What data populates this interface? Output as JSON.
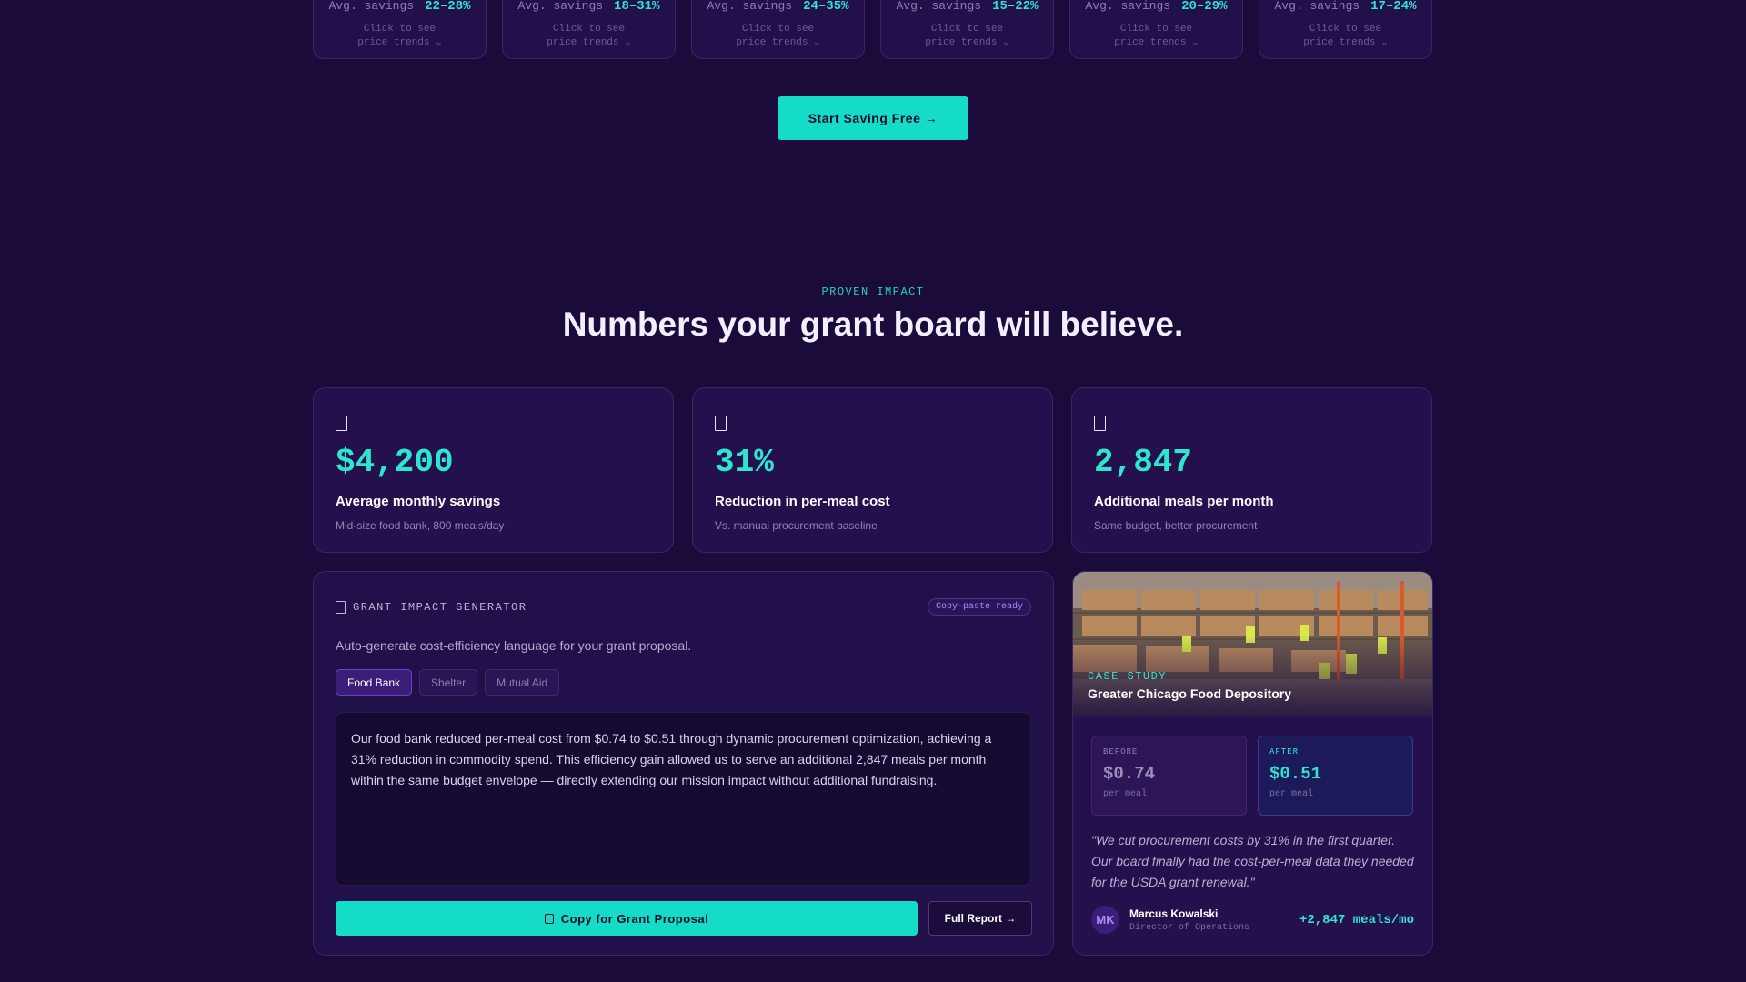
{
  "price_cards": [
    {
      "label": "Avg. savings",
      "value": "22–28%",
      "hint": "Click to see price trends ⌄"
    },
    {
      "label": "Avg. savings",
      "value": "18–31%",
      "hint": "Click to see price trends ⌄"
    },
    {
      "label": "Avg. savings",
      "value": "24–35%",
      "hint": "Click to see price trends ⌄"
    },
    {
      "label": "Avg. savings",
      "value": "15–22%",
      "hint": "Click to see price trends ⌄"
    },
    {
      "label": "Avg. savings",
      "value": "20–29%",
      "hint": "Click to see price trends ⌄"
    },
    {
      "label": "Avg. savings",
      "value": "17–24%",
      "hint": "Click to see price trends ⌄"
    }
  ],
  "cta": {
    "label": "Start Saving Free →"
  },
  "impact": {
    "eyebrow": "PROVEN IMPACT",
    "heading": "Numbers your grant board will believe.",
    "stats": [
      {
        "icon": "document-icon",
        "value": "$4,200",
        "label": "Average monthly savings",
        "sub": "Mid-size food bank, 800 meals/day"
      },
      {
        "icon": "document-icon",
        "value": "31%",
        "label": "Reduction in per-meal cost",
        "sub": "Vs. manual procurement baseline"
      },
      {
        "icon": "document-icon",
        "value": "2,847",
        "label": "Additional meals per month",
        "sub": "Same budget, better procurement"
      }
    ]
  },
  "grant": {
    "title": "GRANT IMPACT GENERATOR",
    "badge": "Copy-paste ready",
    "description": "Auto-generate cost-efficiency language for your grant proposal.",
    "tabs": [
      "Food Bank",
      "Shelter",
      "Mutual Aid"
    ],
    "active_tab": "Food Bank",
    "output_text": "Our food bank reduced per-meal cost from $0.74 to $0.51 through dynamic procurement optimization, achieving a 31% reduction in commodity spend. This efficiency gain allowed us to serve an additional 2,847 meals per month within the same budget envelope — directly extending our mission impact without additional fundraising.",
    "copy_label": "Copy for Grant Proposal",
    "report_label": "Full Report →"
  },
  "case_study": {
    "eyebrow": "CASE STUDY",
    "title": "Greater Chicago Food Depository",
    "before": {
      "label": "BEFORE",
      "value": "$0.74",
      "unit": "per meal"
    },
    "after": {
      "label": "AFTER",
      "value": "$0.51",
      "unit": "per meal"
    },
    "quote": "\"We cut procurement costs by 31% in the first quarter. Our board finally had the cost-per-meal data they needed for the USDA grant renewal.\"",
    "person": {
      "initials": "MK",
      "name": "Marcus Kowalski",
      "role": "Director of Operations"
    },
    "metric": "+2,847 meals/mo"
  },
  "colors": {
    "background": "#1a0b3b",
    "accent": "#14dcc6",
    "card": "#24104d",
    "purple": "#a98af5"
  }
}
